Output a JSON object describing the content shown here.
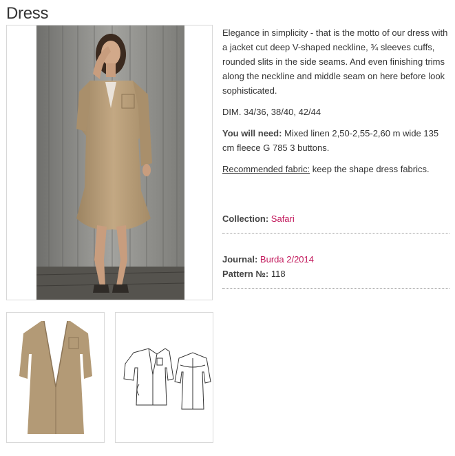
{
  "page": {
    "title": "Dress"
  },
  "description": "Elegance in simplicity - that is the motto of our dress with a jacket cut deep V-shaped neckline, ¾ sleeves cuffs, rounded slits in the side seams. And even finishing trims along the neckline and middle seam on here before look sophisticated.",
  "dimensions": "DIM. 34/36, 38/40, 42/44",
  "need": {
    "label": "You will need:",
    "value": "Mixed linen 2,50-2,55-2,60 m wide 135 cm fleece G 785 3 buttons."
  },
  "fabric": {
    "label": "Recommended fabric:",
    "value": "keep the shape dress fabrics."
  },
  "collection": {
    "label": "Collection:",
    "value": "Safari"
  },
  "journal": {
    "label": "Journal:",
    "value": "Burda 2/2014"
  },
  "pattern": {
    "label": "Pattern №:",
    "value": "118"
  },
  "colors": {
    "link": "#c2185b",
    "dress": "#b99f7c",
    "wood": "#8c8c88",
    "text": "#333333"
  }
}
